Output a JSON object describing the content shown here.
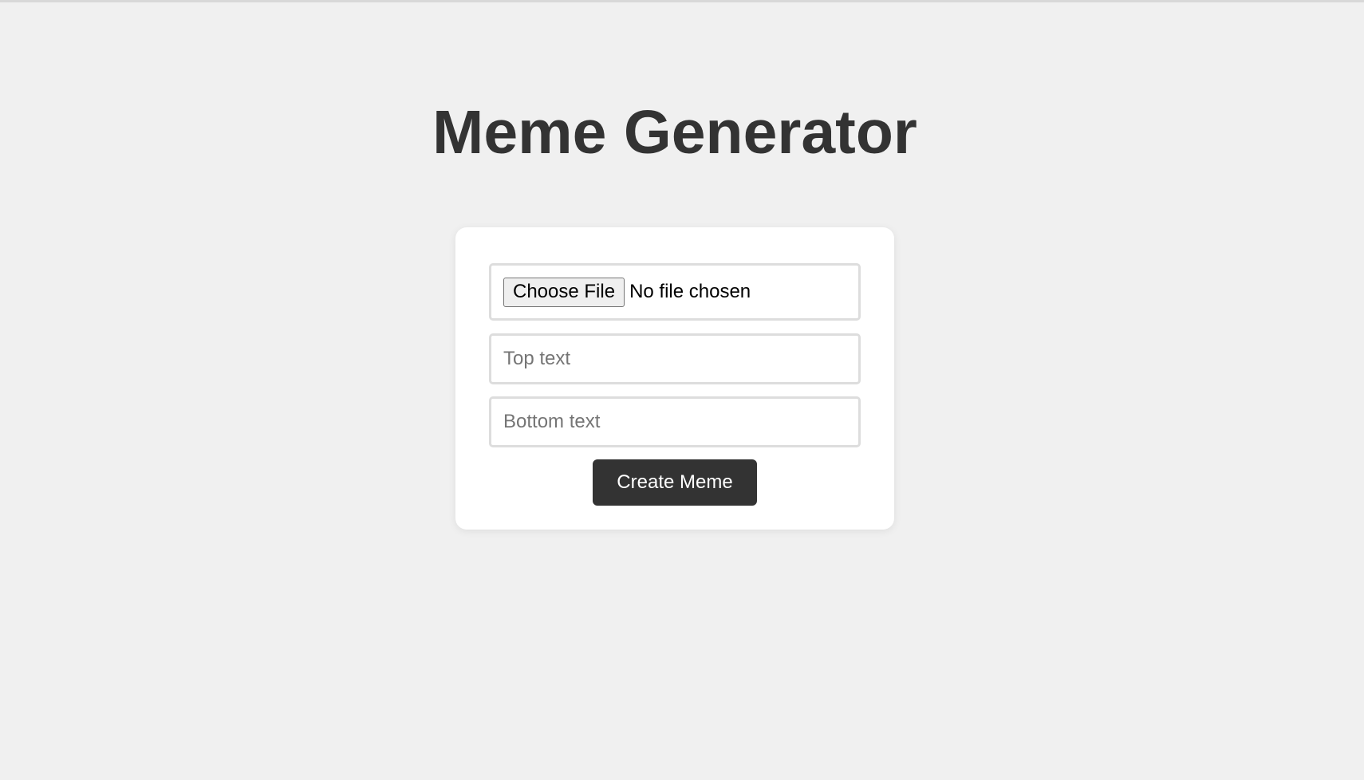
{
  "page": {
    "title": "Meme Generator"
  },
  "form": {
    "file_button_label": "Choose File",
    "file_status": "No file chosen",
    "top_text": {
      "value": "",
      "placeholder": "Top text"
    },
    "bottom_text": {
      "value": "",
      "placeholder": "Bottom text"
    },
    "submit_label": "Create Meme"
  },
  "colors": {
    "background": "#f0f0f0",
    "title": "#333333",
    "card": "#ffffff",
    "field_border": "#dddddd",
    "button_bg": "#333333",
    "button_text": "#ffffff"
  }
}
